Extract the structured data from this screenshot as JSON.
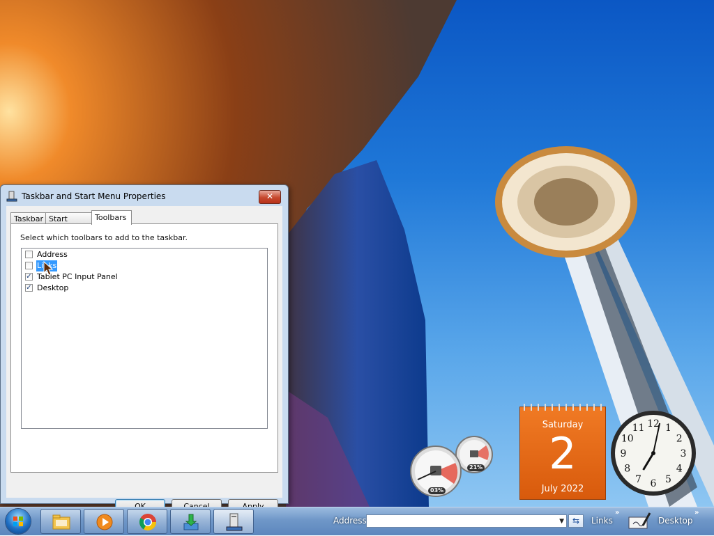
{
  "dialog": {
    "title": "Taskbar and Start Menu Properties",
    "close_glyph": "✕",
    "tabs": [
      {
        "label": "Taskbar",
        "active": false
      },
      {
        "label": "Start Menu",
        "active": false
      },
      {
        "label": "Toolbars",
        "active": true
      }
    ],
    "description": "Select which toolbars to add to the taskbar.",
    "toolbars": [
      {
        "label": "Address",
        "checked": false,
        "selected": false
      },
      {
        "label": "Links",
        "checked": false,
        "selected": true
      },
      {
        "label": "Tablet PC Input Panel",
        "checked": true,
        "selected": false
      },
      {
        "label": "Desktop",
        "checked": true,
        "selected": false
      }
    ],
    "buttons": {
      "ok": "OK",
      "cancel": "Cancel",
      "apply": "Apply"
    }
  },
  "gadgets": {
    "calendar": {
      "weekday": "Saturday",
      "day": "2",
      "month_year": "July 2022",
      "color": "#e56a14"
    },
    "cpu_meter": {
      "cpu_percent": "03%",
      "memory_percent": "21%"
    },
    "clock": {
      "numerals": [
        "12",
        "1",
        "2",
        "3",
        "4",
        "5",
        "6",
        "7",
        "8",
        "9",
        "10",
        "11"
      ],
      "hour": 7,
      "minute": 2
    }
  },
  "taskbar": {
    "icons": [
      "start-orb",
      "explorer-icon",
      "media-player-icon",
      "chrome-icon",
      "download-icon",
      "taskbar-properties-icon"
    ],
    "address_label": "Address",
    "address_value": "",
    "go_glyph": "⇆",
    "links_label": "Links",
    "chevron": "»",
    "desktop_label": "Desktop",
    "accent": "#6f97c8"
  }
}
